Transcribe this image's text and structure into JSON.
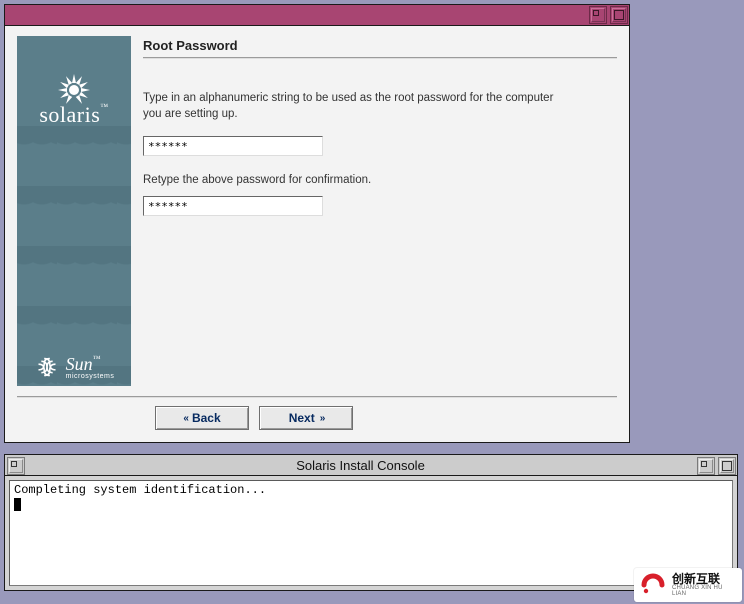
{
  "installer": {
    "brand": "solaris",
    "brand_tm": "™",
    "vendor_big": "Sun",
    "vendor_small": "microsystems",
    "heading": "Root Password",
    "instructions": "Type in an alphanumeric string to be used as the root password for the computer you are setting up.",
    "password_value": "******",
    "confirm_label": "Retype the above password for confirmation.",
    "confirm_value": "******",
    "back_label": "Back",
    "next_label": "Next"
  },
  "console": {
    "title": "Solaris Install Console",
    "line1": "Completing system identification..."
  },
  "watermark": {
    "cn": "创新互联",
    "en": "CHUANG XIN HU LIAN"
  }
}
